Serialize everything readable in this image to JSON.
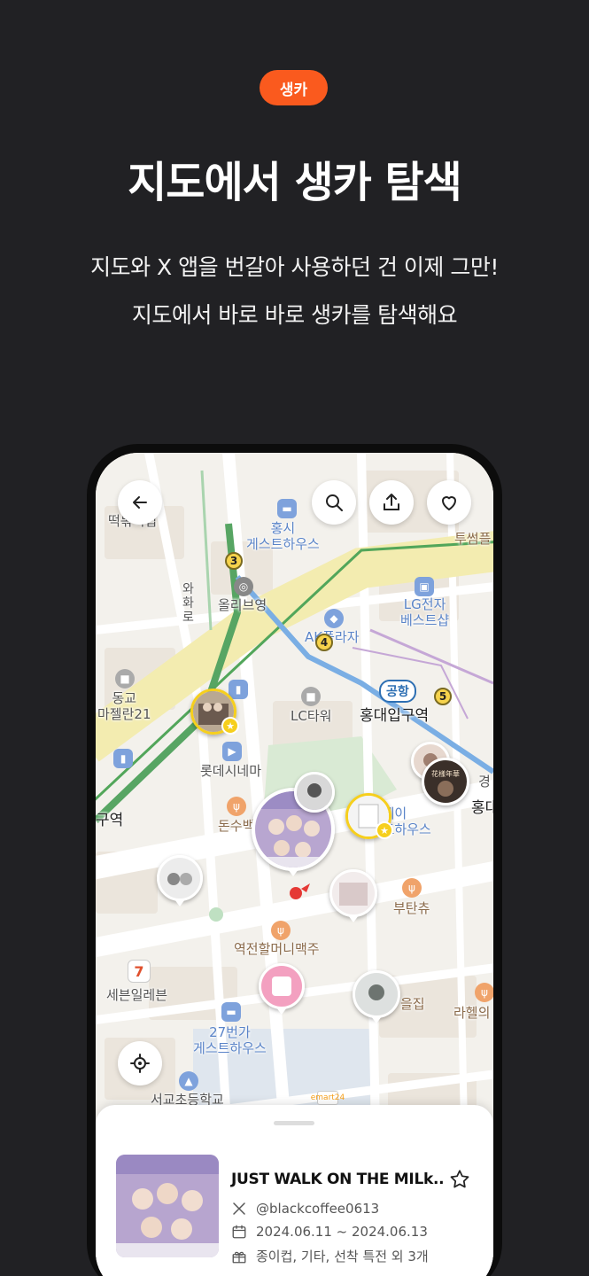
{
  "badge": "생카",
  "headline": "지도에서 생카 탐색",
  "subtitle_lines": [
    "지도와 X 앱을 번갈아 사용하던 건 이제 그만!",
    "지도에서 바로 바로 생카를 탐색해요"
  ],
  "map": {
    "labels": {
      "tteokbokki": "떡볶이집",
      "hongsi_guesthouse": "홍시\n게스트하우스",
      "tussum": "투썸플",
      "hwaro": "와\n화\n로",
      "olive_young": "올리브영",
      "lg_bestshop": "LG전자\n베스트샵",
      "ak_plaza": "AK플라자",
      "donggyo": "동교\n마젤란21",
      "lc_tower": "LC타워",
      "airport_line": "공항",
      "hongik_station": "홍대입구역",
      "lotte_cinema": "롯데시네마",
      "station_left": "구역",
      "donsu": "돈수백",
      "day_guesthouse": "데이\n게스트하우스",
      "hongdae_right": "홍대",
      "butanchu": "부탄츄",
      "yeokjeon": "역전할머니맥주",
      "seven_eleven": "세븐일레븐",
      "house_27": "27번가\n게스트하우스",
      "ulj": "을집",
      "lahel": "라헬의",
      "school": "서교초등학교",
      "gyeong": "경"
    },
    "line_numbers": [
      "3",
      "4",
      "5"
    ],
    "emart_label": "emart24"
  },
  "icons": {
    "back": "back-arrow-icon",
    "search": "search-icon",
    "share": "share-icon",
    "like": "heart-icon",
    "locate": "locate-icon"
  },
  "event_card": {
    "title": "JUST WALK ON THE MILk..",
    "account": "@blackcoffee0613",
    "dates": "2024.06.11 ~ 2024.06.13",
    "benefits": "종이컵, 기타, 선착 특전 외 3개"
  },
  "colors": {
    "background": "#212124",
    "accent": "#fa5a1e",
    "pin_highlight": "#f6cf1d"
  }
}
